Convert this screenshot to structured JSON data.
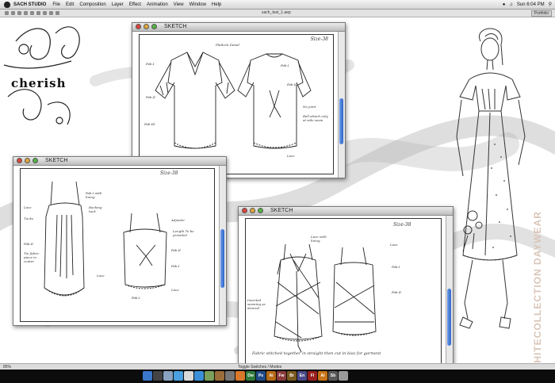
{
  "menubar": {
    "app_name": "SACH STUDIO",
    "items": [
      "File",
      "Edit",
      "Composition",
      "Layer",
      "Effect",
      "Animation",
      "View",
      "Window",
      "Help"
    ],
    "clock": "Sun 6:04 PM"
  },
  "toolbar": {
    "document_title": "sach_test_1.aep",
    "workspace": "Portfolio"
  },
  "status": {
    "zoom": "85%",
    "mode_label": "Toggle Switches / Modes"
  },
  "brand": {
    "logo_text": "cherish"
  },
  "side_title": "WHITECOLLECTION DAYWEAR",
  "windows": [
    {
      "title": "SKETCH",
      "size": "Size-38",
      "notes": [
        "Fab.I",
        "Fab.II",
        "Fab.III",
        "Lace",
        "Flatlock Detail",
        "Fab.I",
        "Fab.II",
        "Lace",
        "No joint",
        "Bell attach only at side seam"
      ]
    },
    {
      "title": "SKETCH",
      "size": "Size-38",
      "notes": [
        "Fab.I with lining",
        "Racking tuck",
        "Lace",
        "Lace",
        "Tucks",
        "Fab.II",
        "Tie fabric piece in center",
        "Adjuster",
        "Length To be provided",
        "Fab.II",
        "Fab.I",
        "Lace",
        "Fab.I"
      ]
    },
    {
      "title": "SKETCH",
      "size": "Size-38",
      "notes": [
        "Lace with lining",
        "Lace",
        "Fab.I",
        "Fab.II",
        "Inverted seaming as desired",
        "Fabric stitched together in straight then cut in bias for garment"
      ]
    }
  ],
  "dock_apps": [
    "Dw",
    "Ps",
    "Ai",
    "Fw",
    "Br",
    "En",
    "Fl",
    "Ai",
    "Sb"
  ],
  "colors": {
    "window_accent": "#2c64c9",
    "title_red": "#e0443b",
    "title_yellow": "#e2a83a",
    "title_green": "#53b443"
  }
}
